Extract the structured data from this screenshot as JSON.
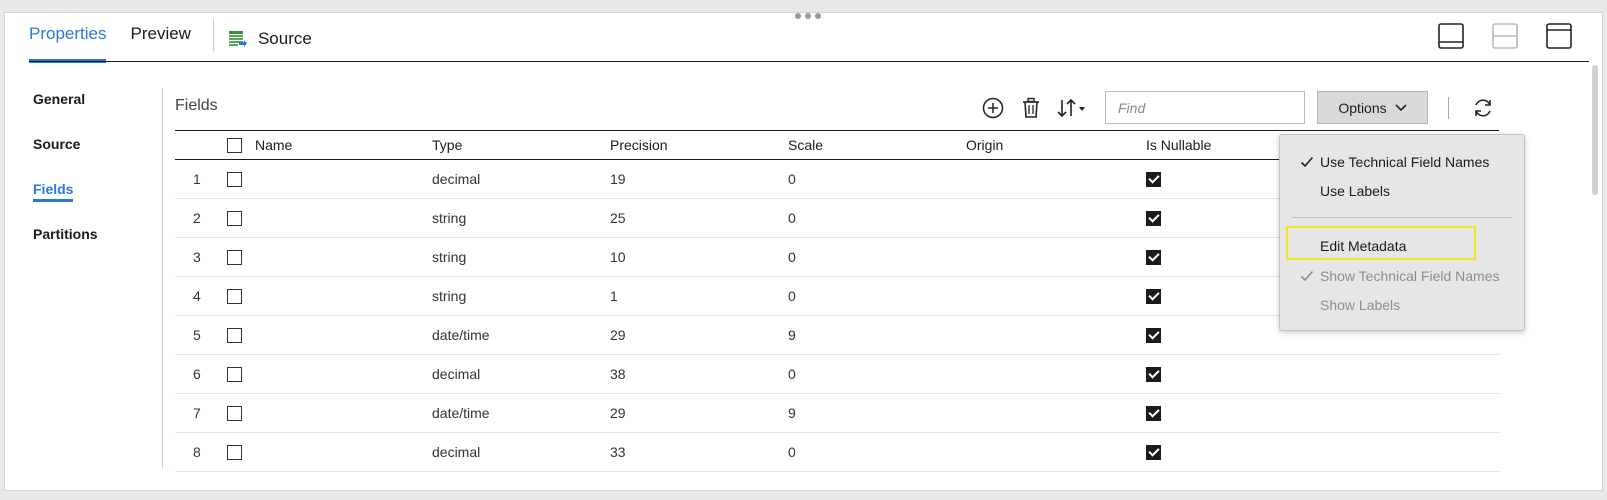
{
  "tabs": [
    {
      "label": "Properties",
      "active": true
    },
    {
      "label": "Preview",
      "active": false
    }
  ],
  "source_tab": {
    "label": "Source",
    "icon": "table-source-icon"
  },
  "nav": [
    {
      "label": "General",
      "active": false
    },
    {
      "label": "Source",
      "active": false
    },
    {
      "label": "Fields",
      "active": true
    },
    {
      "label": "Partitions",
      "active": false
    }
  ],
  "fields_title": "Fields",
  "find_placeholder": "Find",
  "options_label": "Options",
  "columns": {
    "name": "Name",
    "type": "Type",
    "precision": "Precision",
    "scale": "Scale",
    "origin": "Origin",
    "nullable": "Is Nullable"
  },
  "rows": [
    {
      "num": "1",
      "type": "decimal",
      "precision": "19",
      "scale": "0"
    },
    {
      "num": "2",
      "type": "string",
      "precision": "25",
      "scale": "0"
    },
    {
      "num": "3",
      "type": "string",
      "precision": "10",
      "scale": "0"
    },
    {
      "num": "4",
      "type": "string",
      "precision": "1",
      "scale": "0"
    },
    {
      "num": "5",
      "type": "date/time",
      "precision": "29",
      "scale": "9"
    },
    {
      "num": "6",
      "type": "decimal",
      "precision": "38",
      "scale": "0"
    },
    {
      "num": "7",
      "type": "date/time",
      "precision": "29",
      "scale": "9"
    },
    {
      "num": "8",
      "type": "decimal",
      "precision": "33",
      "scale": "0"
    }
  ],
  "menu": {
    "use_technical": "Use Technical Field Names",
    "use_labels": "Use Labels",
    "edit_metadata": "Edit Metadata",
    "show_technical": "Show Technical Field Names",
    "show_labels": "Show Labels"
  },
  "colors": {
    "accent": "#2b78d6",
    "highlight": "#f4e21d"
  }
}
